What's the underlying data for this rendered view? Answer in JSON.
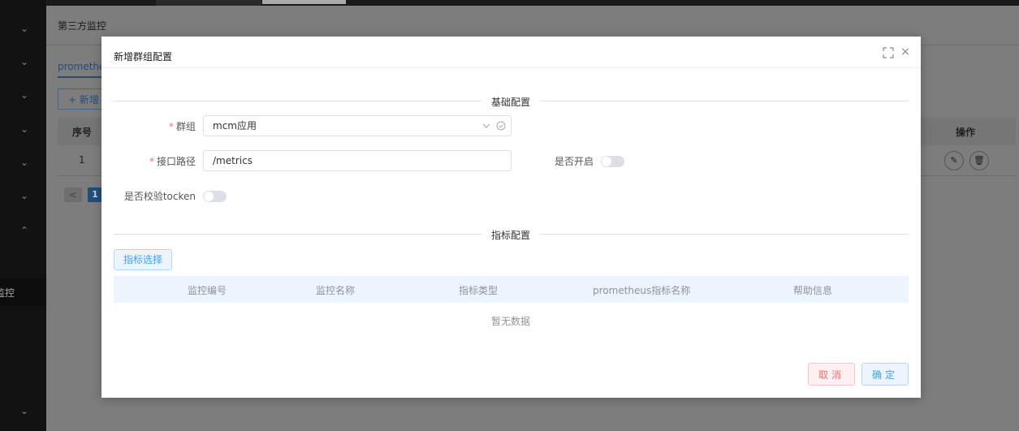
{
  "background": {
    "breadcrumb_title": "第三方监控",
    "sidebar_items": [
      "监控"
    ],
    "tab_label": "promethe",
    "add_button_label": "+ 新增",
    "table_headers": {
      "seq": "序号",
      "ops": "操作"
    },
    "table_row": {
      "seq": "1"
    },
    "pager": {
      "prev": "<",
      "current": "1"
    }
  },
  "modal": {
    "title": "新增群组配置",
    "section_basic": "基础配置",
    "section_metric": "指标配置",
    "fields": {
      "group_label": "群组",
      "group_value": "mcm应用",
      "path_label": "接口路径",
      "path_value": "/metrics",
      "enabled_label": "是否开启",
      "token_label": "是否校验tocken"
    },
    "metric_select_button": "指标选择",
    "metric_table": {
      "columns": [
        "监控编号",
        "监控名称",
        "指标类型",
        "prometheus指标名称",
        "帮助信息"
      ],
      "empty_text": "暂无数据"
    },
    "footer": {
      "cancel": "取消",
      "confirm": "确定"
    }
  },
  "colors": {
    "primary": "#409eff",
    "danger": "#f56c6c",
    "table_header_bg": "#ecf4fd"
  }
}
